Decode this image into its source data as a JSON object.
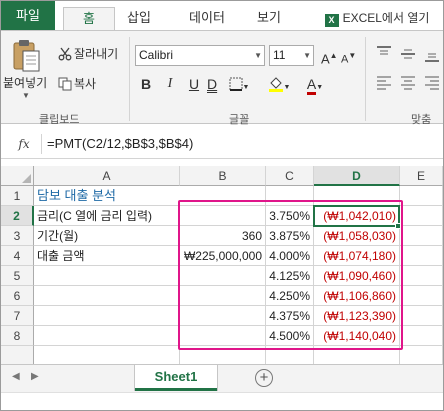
{
  "ribbon": {
    "tabs": [
      {
        "label": "파일"
      },
      {
        "label": "홈"
      },
      {
        "label": "삽입"
      },
      {
        "label": "데이터"
      },
      {
        "label": "보기"
      },
      {
        "label": "EXCEL에서 열기",
        "icon": "excel-logo-icon"
      }
    ],
    "active_tab": "홈",
    "clipboard": {
      "paste_label": "붙여넣기",
      "cut_label": "잘라내기",
      "copy_label": "복사",
      "group_label": "클립보드"
    },
    "font": {
      "font_name": "Calibri",
      "font_size": "11",
      "group_label": "글꼴",
      "bold": "B",
      "italic": "I",
      "underline": "U",
      "font_color_letter": "A"
    },
    "alignment": {
      "group_label": "맞춤"
    },
    "colors": {
      "accent": "#217346",
      "font_color_bar": "#c00000",
      "fill_color_bar": "#ffff00"
    }
  },
  "formula_bar": {
    "fx_label": "fx",
    "formula": "=PMT(C2/12,$B$3,$B$4)"
  },
  "grid": {
    "columns": [
      "A",
      "B",
      "C",
      "D",
      "E"
    ],
    "selected_column": "D",
    "rows": [
      "1",
      "2",
      "3",
      "4",
      "5",
      "6",
      "7",
      "8"
    ],
    "selected_row": "2",
    "cells": {
      "A1": "담보 대출 분석",
      "A2": "금리(C 열에 금리 입력)",
      "A3": "기간(월)",
      "A4": "대출 금액",
      "B3": "360",
      "B4": "₩225,000,000",
      "C2": "3.750%",
      "C3": "3.875%",
      "C4": "4.000%",
      "C5": "4.125%",
      "C6": "4.250%",
      "C7": "4.375%",
      "C8": "4.500%",
      "D2": "(₩1,042,010)",
      "D3": "(₩1,058,030)",
      "D4": "(₩1,074,180)",
      "D5": "(₩1,090,460)",
      "D6": "(₩1,106,860)",
      "D7": "(₩1,123,390)",
      "D8": "(₩1,140,040)"
    },
    "colors": {
      "negative": "#c00000",
      "title": "#1f6aa6",
      "highlight_box": "#e0158a"
    }
  },
  "sheets": {
    "tabs": [
      "Sheet1"
    ],
    "active": "Sheet1",
    "add_label": "+"
  }
}
